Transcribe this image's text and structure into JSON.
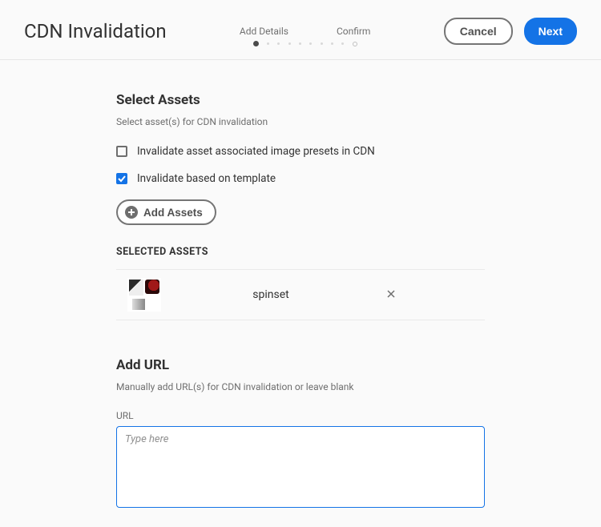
{
  "header": {
    "title": "CDN Invalidation",
    "steps": [
      {
        "label": "Add Details",
        "active": true
      },
      {
        "label": "Confirm",
        "active": false
      }
    ],
    "cancel": "Cancel",
    "next": "Next"
  },
  "selectAssets": {
    "heading": "Select Assets",
    "sub": "Select asset(s) for CDN invalidation",
    "checkboxes": [
      {
        "label": "Invalidate asset associated image presets in CDN",
        "checked": false
      },
      {
        "label": "Invalidate based on template",
        "checked": true
      }
    ],
    "addButton": "Add Assets",
    "selectedLabel": "SELECTED ASSETS",
    "assets": [
      {
        "name": "spinset"
      }
    ]
  },
  "addUrl": {
    "heading": "Add URL",
    "sub": "Manually add URL(s) for CDN invalidation or leave blank",
    "label": "URL",
    "placeholder": "Type here",
    "value": ""
  }
}
